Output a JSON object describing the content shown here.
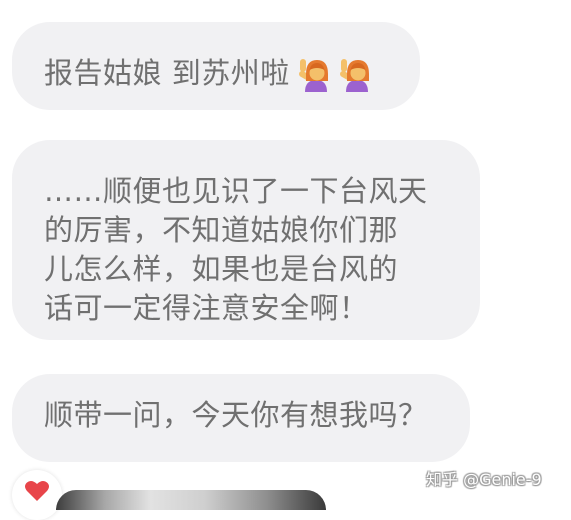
{
  "messages": [
    {
      "text": "报告姑娘 到苏州啦",
      "emoji": [
        "person-raising-hand-emoji",
        "person-raising-hand-emoji"
      ]
    },
    {
      "text": "……顺便也见识了一下台风天\n的厉害，不知道姑娘你们那\n儿怎么样，如果也是台风的\n话可一定得注意安全啊！"
    },
    {
      "text": "顺带一问，今天你有想我吗？"
    }
  ],
  "reaction": {
    "icon": "heart-icon",
    "color": "#e8454a"
  },
  "watermark": "知乎 @Genie-9"
}
